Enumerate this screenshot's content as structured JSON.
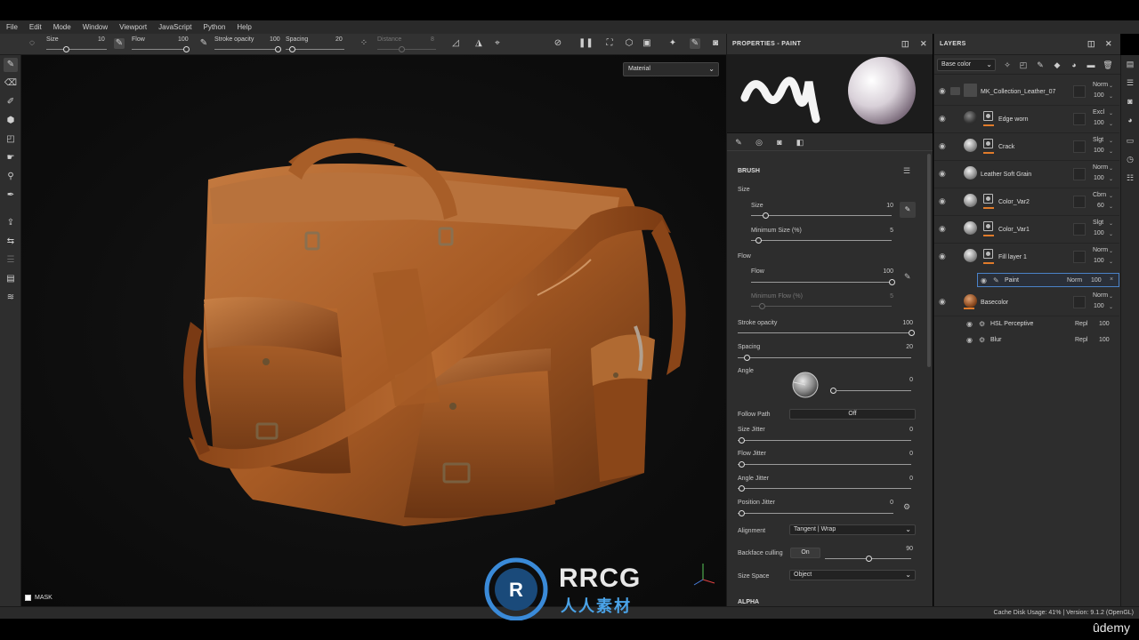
{
  "menu": [
    "File",
    "Edit",
    "Mode",
    "Window",
    "Viewport",
    "JavaScript",
    "Python",
    "Help"
  ],
  "toolbar": {
    "size_label": "Size",
    "size_value": "10",
    "flow_label": "Flow",
    "flow_value": "100",
    "stroke_label": "Stroke opacity",
    "stroke_value": "100",
    "spacing_label": "Spacing",
    "spacing_value": "20",
    "distance_label": "Distance",
    "distance_value": "8"
  },
  "viewport": {
    "mode_select": "Material",
    "mask_label": "MASK"
  },
  "properties": {
    "title": "PROPERTIES - PAINT",
    "brush_title": "BRUSH",
    "size_section": "Size",
    "size_label": "Size",
    "size_value": "10",
    "size_level": 0.1,
    "min_size_label": "Minimum Size (%)",
    "min_size_value": "5",
    "min_size_level": 0.05,
    "flow_section": "Flow",
    "flow_label": "Flow",
    "flow_value": "100",
    "flow_level": 1.0,
    "min_flow_label": "Minimum Flow (%)",
    "min_flow_value": "5",
    "stroke_label": "Stroke opacity",
    "stroke_value": "100",
    "stroke_level": 1.0,
    "spacing_label": "Spacing",
    "spacing_value": "20",
    "spacing_level": 0.05,
    "angle_label": "Angle",
    "angle_value": "0",
    "follow_path_label": "Follow Path",
    "follow_path_value": "Off",
    "size_jitter_label": "Size Jitter",
    "size_jitter_value": "0",
    "flow_jitter_label": "Flow Jitter",
    "flow_jitter_value": "0",
    "angle_jitter_label": "Angle Jitter",
    "angle_jitter_value": "0",
    "position_jitter_label": "Position Jitter",
    "position_jitter_value": "0",
    "alignment_label": "Alignment",
    "alignment_value": "Tangent | Wrap",
    "backface_label": "Backface culling",
    "backface_toggle": "On",
    "backface_value": "90",
    "backface_level": 0.5,
    "size_space_label": "Size Space",
    "size_space_value": "Object",
    "alpha_title": "ALPHA"
  },
  "layers": {
    "title": "LAYERS",
    "channel_select": "Base color",
    "rows": [
      {
        "name": "MK_Collection_Leather_07",
        "blend": "Norm",
        "opacity": "100"
      },
      {
        "name": "Edge worn",
        "blend": "Excl",
        "opacity": "100"
      },
      {
        "name": "Crack",
        "blend": "Slgt",
        "opacity": "100"
      },
      {
        "name": "Leather Soft Grain",
        "blend": "Norm",
        "opacity": "100"
      },
      {
        "name": "Color_Var2",
        "blend": "Cbrn",
        "opacity": "60"
      },
      {
        "name": "Color_Var1",
        "blend": "Slgt",
        "opacity": "100"
      },
      {
        "name": "Fill layer 1",
        "blend": "Norm",
        "opacity": "100"
      },
      {
        "name": "Basecolor",
        "blend": "Norm",
        "opacity": "100"
      }
    ],
    "sub": [
      {
        "name": "Paint",
        "blend": "Norm",
        "opacity": "100"
      },
      {
        "name": "HSL Perceptive",
        "blend": "Repl",
        "opacity": "100"
      },
      {
        "name": "Blur",
        "blend": "Repl",
        "opacity": "100"
      }
    ]
  },
  "status": {
    "text": "Cache Disk Usage:   41% | Version: 9.1.2 (OpenGL)"
  },
  "watermark": {
    "line1": "RRCG",
    "line2": "人人素材"
  },
  "branding": {
    "udemy": "ûdemy"
  },
  "colors": {
    "accent_orange": "#e07b2a",
    "selection_blue": "#4a82c8",
    "leather": "#a85a26"
  }
}
